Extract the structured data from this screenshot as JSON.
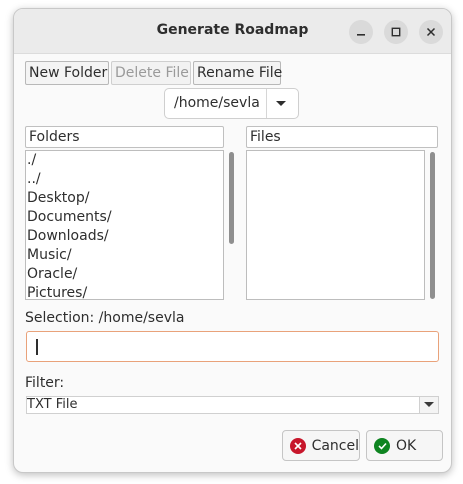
{
  "window": {
    "title": "Generate Roadmap"
  },
  "toolbar": {
    "new_folder": "New Folder",
    "delete_file": "Delete File",
    "rename_file": "Rename File"
  },
  "path_combo": {
    "value": "/home/sevla"
  },
  "folders": {
    "header": "Folders",
    "items": [
      "./",
      "../",
      "Desktop/",
      "Documents/",
      "Downloads/",
      "Music/",
      "Oracle/",
      "Pictures/"
    ]
  },
  "files": {
    "header": "Files",
    "items": []
  },
  "selection": {
    "label": "Selection: /home/sevla",
    "value": ""
  },
  "filter": {
    "label": "Filter:",
    "value": "TXT File"
  },
  "actions": {
    "cancel": "Cancel",
    "ok": "OK"
  },
  "colors": {
    "cancel_icon": "#c7162b",
    "ok_icon": "#0e8420",
    "focus_border": "#e9a27a"
  }
}
